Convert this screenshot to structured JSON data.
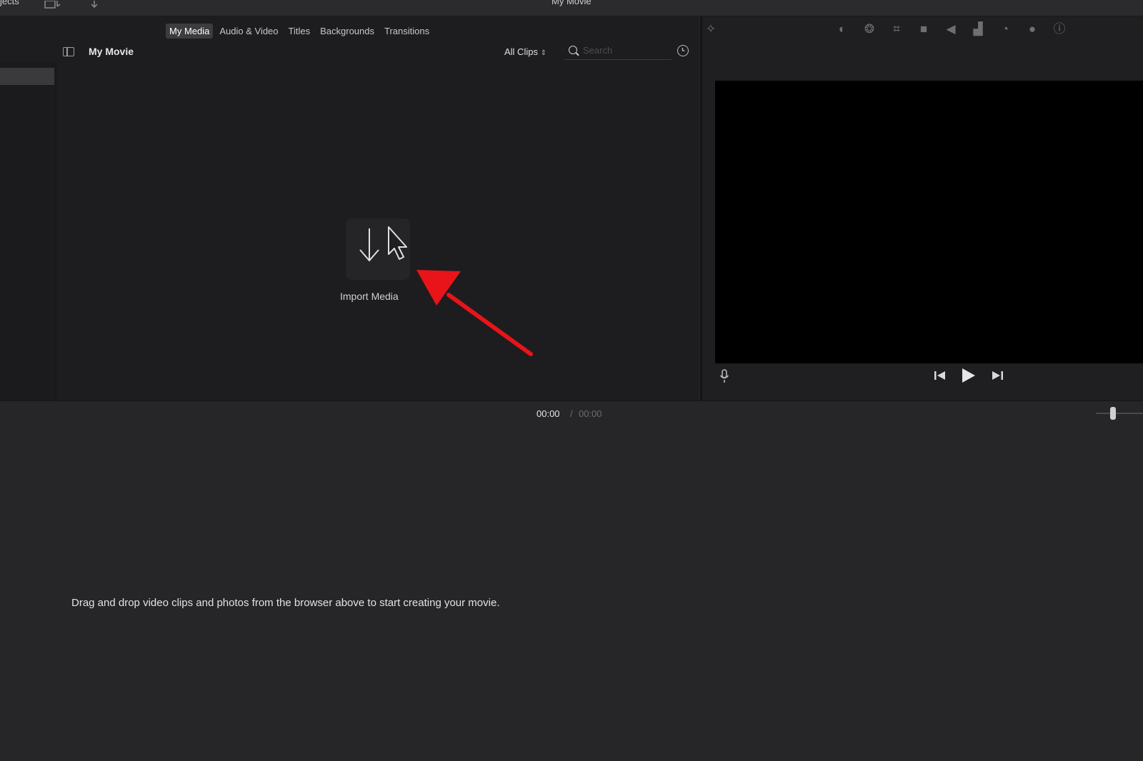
{
  "window": {
    "projects_label": "jects",
    "title": "My Movie"
  },
  "browser": {
    "tabs": [
      {
        "label": "My Media",
        "active": true
      },
      {
        "label": "Audio & Video",
        "active": false
      },
      {
        "label": "Titles",
        "active": false
      },
      {
        "label": "Backgrounds",
        "active": false
      },
      {
        "label": "Transitions",
        "active": false
      }
    ],
    "project_name": "My Movie",
    "filter_label": "All Clips",
    "search_placeholder": "Search",
    "import_label": "Import Media"
  },
  "timeline": {
    "current_time": "00:00",
    "separator": "/",
    "total_time": "00:00",
    "hint": "Drag and drop video clips and photos from the browser above to start creating your movie."
  },
  "icons": {
    "toolbar": [
      "magic-wand-icon",
      "color-balance-icon",
      "color-correction-icon",
      "crop-icon",
      "stabilization-icon",
      "volume-icon",
      "equalizer-icon",
      "speed-icon",
      "noise-reduction-icon",
      "info-icon"
    ],
    "playback": [
      "skip-back-icon",
      "play-icon",
      "skip-forward-icon"
    ]
  },
  "colors": {
    "annotation_arrow": "#e8141a",
    "active_tab": "#3c3c3e",
    "background": "#232325"
  }
}
